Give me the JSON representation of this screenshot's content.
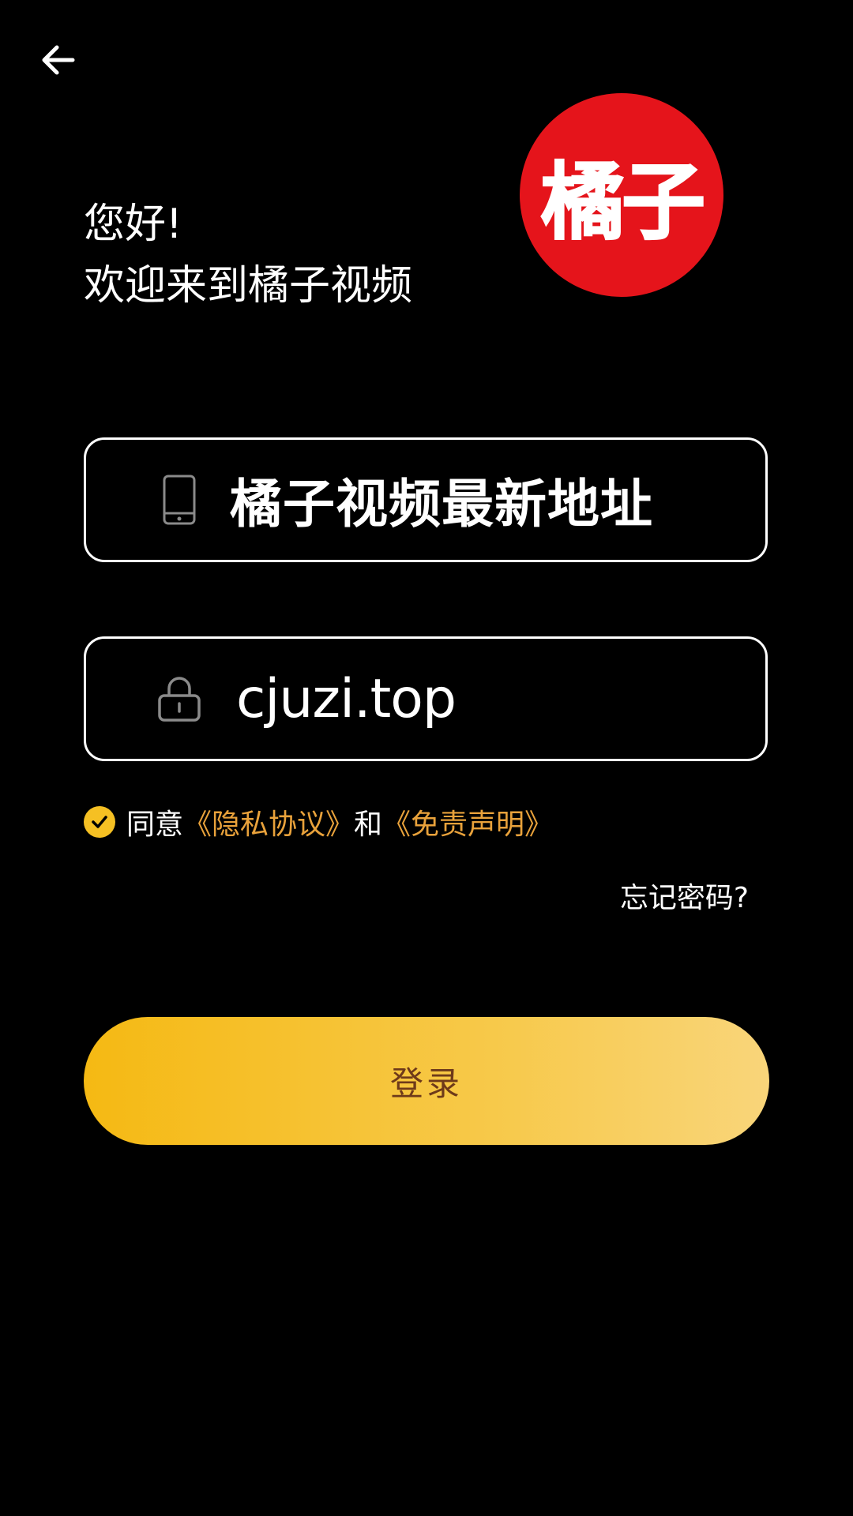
{
  "header": {
    "back_icon": "arrow-left-icon"
  },
  "greeting": {
    "line1": "您好!",
    "line2": "欢迎来到橘子视频"
  },
  "logo": {
    "text": "橘子",
    "color": "#e5141b"
  },
  "phone_field": {
    "icon": "phone-icon",
    "value": "橘子视频最新地址"
  },
  "password_field": {
    "icon": "lock-icon",
    "value": "cjuzi.top"
  },
  "agreement": {
    "checked": true,
    "prefix": "同意",
    "privacy_link": "《隐私协议》",
    "conjunction": "和",
    "disclaimer_link": "《免责声明》",
    "link_color": "#e9a23b"
  },
  "forgot_password": "忘记密码?",
  "login_button": {
    "label": "登录",
    "color": "#f5b913"
  }
}
